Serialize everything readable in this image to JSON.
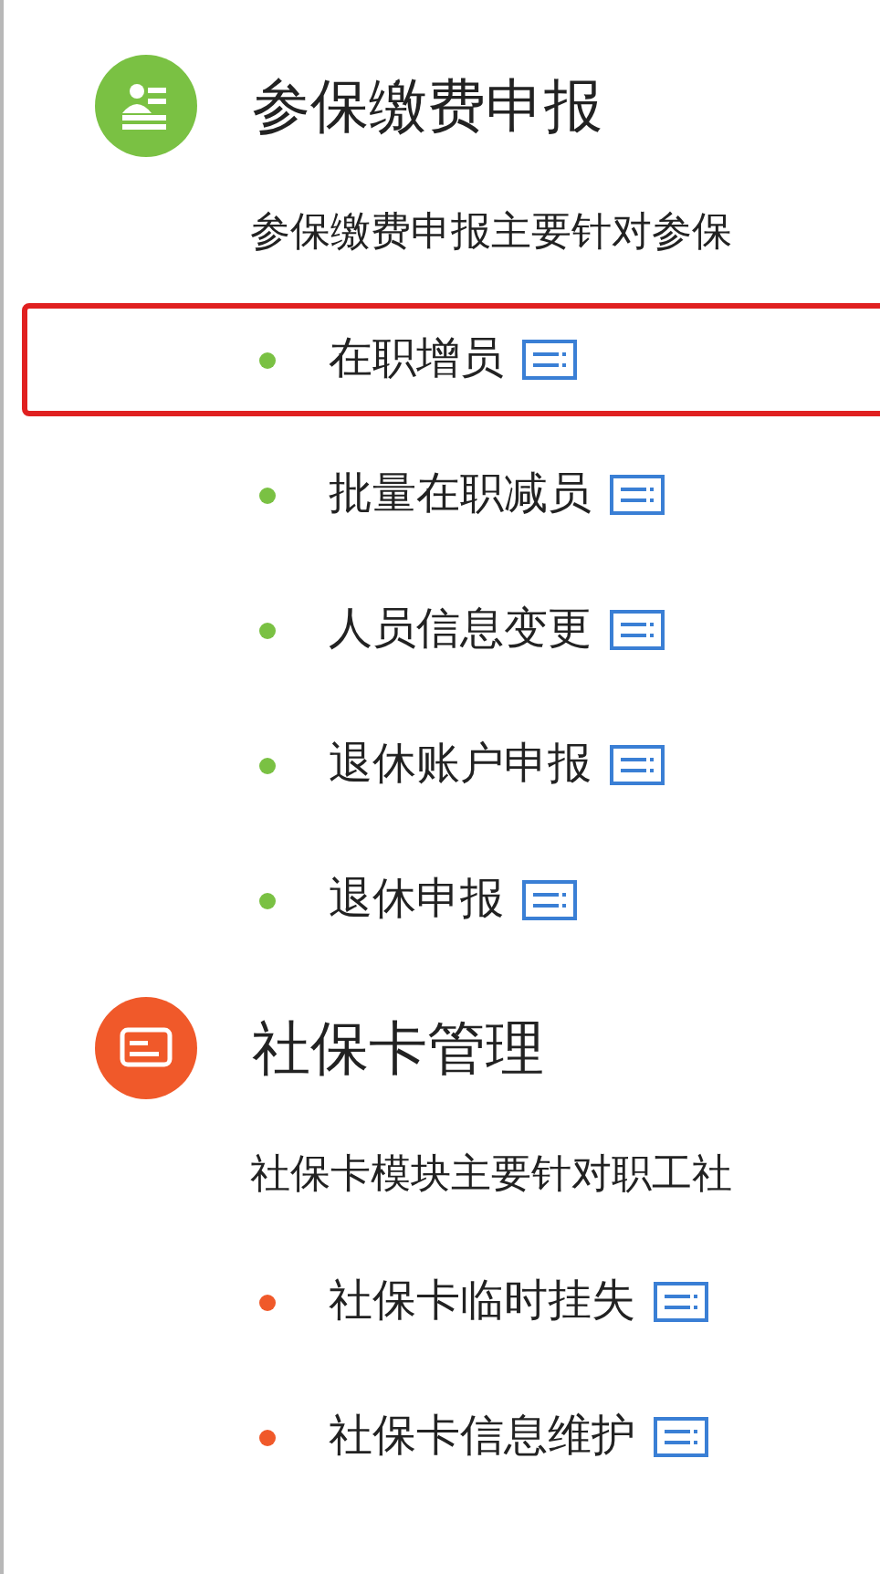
{
  "sections": [
    {
      "kind": "person",
      "color": "#7ac143",
      "title": "参保缴费申报",
      "description": "参保缴费申报主要针对参保",
      "items": [
        {
          "label": "在职增员",
          "selected": true
        },
        {
          "label": "批量在职减员",
          "selected": false
        },
        {
          "label": "人员信息变更",
          "selected": false
        },
        {
          "label": "退休账户申报",
          "selected": false
        },
        {
          "label": "退休申报",
          "selected": false
        }
      ]
    },
    {
      "kind": "card",
      "color": "#f0592a",
      "title": "社保卡管理",
      "description": "社保卡模块主要针对职工社",
      "items": [
        {
          "label": "社保卡临时挂失",
          "selected": false
        },
        {
          "label": "社保卡信息维护",
          "selected": false
        }
      ]
    }
  ]
}
